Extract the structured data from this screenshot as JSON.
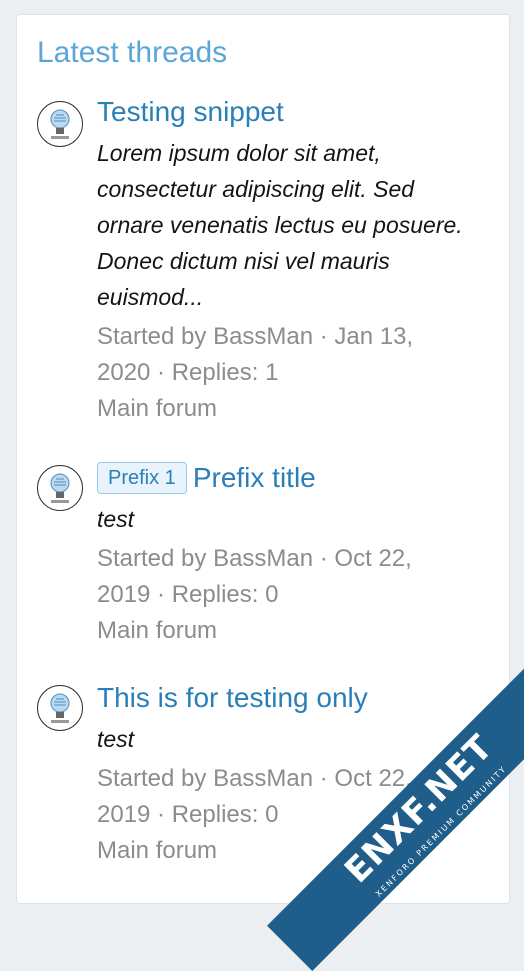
{
  "block": {
    "title": "Latest threads"
  },
  "threads": [
    {
      "title": "Testing snippet",
      "prefix": "",
      "snippet": "Lorem ipsum dolor sit amet, consectetur adipiscing elit. Sed ornare venenatis lectus eu posuere. Donec dictum nisi vel mauris euismod...",
      "meta_line1": "Started by BassMan · Jan 13,",
      "meta_line2": "2020 · Replies: 1",
      "forum": "Main forum"
    },
    {
      "title": "Prefix title",
      "prefix": "Prefix 1",
      "snippet": "test",
      "meta_line1": "Started by BassMan · Oct 22,",
      "meta_line2": "2019 · Replies: 0",
      "forum": "Main forum"
    },
    {
      "title": "This is for testing only",
      "prefix": "",
      "snippet": "test",
      "meta_line1": "Started by BassMan · Oct 22,",
      "meta_line2": "2019 · Replies: 0",
      "forum": "Main forum"
    }
  ],
  "watermark": {
    "brand": "ENXF.NET",
    "tagline": "XENFORO PREMIUM COMMUNITY"
  },
  "colors": {
    "title": "#5aa6d9",
    "link": "#2a7fb8",
    "meta": "#8c8c8c",
    "watermark": "#1f5d8a"
  }
}
